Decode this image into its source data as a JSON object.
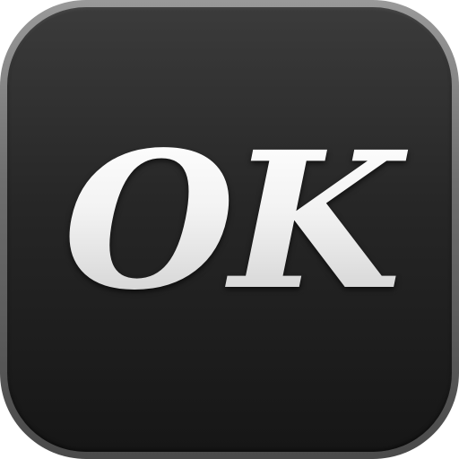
{
  "app_icon": {
    "wordmark": "OK",
    "colors": {
      "frame": "#7a7a7a",
      "face_top": "#3b3b3b",
      "face_bottom": "#161616",
      "text": "#ececec"
    }
  }
}
